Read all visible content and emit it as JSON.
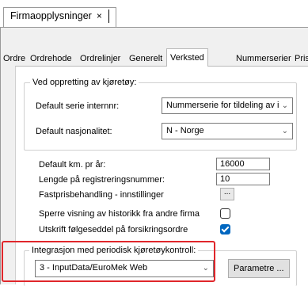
{
  "document_tab": {
    "title": "Firmaopplysninger",
    "close_glyph": "×"
  },
  "tabs": [
    {
      "label": "Ordre"
    },
    {
      "label": "Ordrehode"
    },
    {
      "label": "Ordrelinjer"
    },
    {
      "label": "Generelt"
    },
    {
      "label": "Verksted",
      "active": true
    },
    {
      "label": "Nummerserier"
    },
    {
      "label": "Pris"
    }
  ],
  "vehicle_creation": {
    "group_title": "Ved oppretting av kjøretøy:",
    "default_series_label": "Default serie internnr:",
    "default_series_value": "Nummerserie for tildeling av i",
    "default_nationality_label": "Default nasjonalitet:",
    "default_nationality_value": "N - Norge"
  },
  "settings": {
    "default_km_label": "Default km. pr år:",
    "default_km_value": "16000",
    "reg_length_label": "Lengde på registreringsnummer:",
    "reg_length_value": "10",
    "fixed_price_label": "Fastprisbehandling - innstillinger",
    "fixed_price_button": "...",
    "block_history_label": "Sperre visning av historikk fra andre firma",
    "block_history_checked": false,
    "print_delivery_label": "Utskrift følgeseddel på forsikringsordre",
    "print_delivery_checked": true
  },
  "integration": {
    "group_title": "Integrasjon med periodisk kjøretøykontroll:",
    "selected": "3 - InputData/EuroMek Web",
    "parameters_button": "Parametre ..."
  },
  "colors": {
    "highlight": "#e0262b",
    "checkbox_accent": "#0067c0"
  },
  "icons": {
    "dropdown": "chevron-down-icon",
    "close": "close-icon",
    "check": "check-icon"
  }
}
